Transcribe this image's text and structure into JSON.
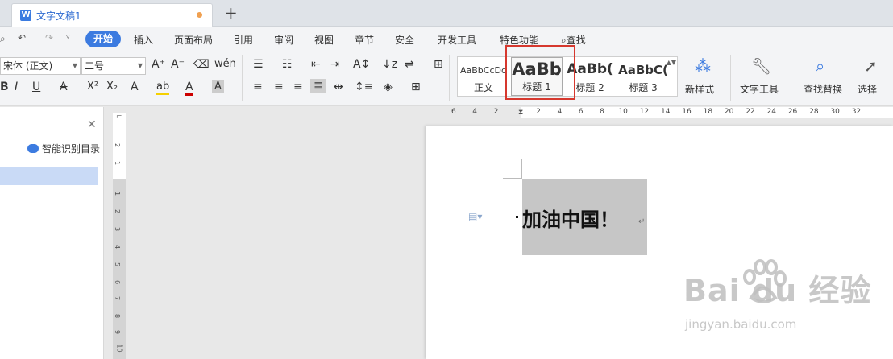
{
  "tabs": {
    "doc_title": "文字文稿1",
    "new_tab": "+"
  },
  "menu": {
    "items": [
      "开始",
      "插入",
      "页面布局",
      "引用",
      "审阅",
      "视图",
      "章节",
      "安全",
      "开发工具",
      "特色功能"
    ],
    "search": "查找"
  },
  "ribbon": {
    "font_name": "宋体 (正文)",
    "font_size": "二号",
    "styles": [
      {
        "sample": "AaBbCcDd",
        "label": "正文"
      },
      {
        "sample": "AaBb",
        "label": "标题 1"
      },
      {
        "sample": "AaBb(",
        "label": "标题 2"
      },
      {
        "sample": "AaBbC(",
        "label": "标题 3"
      }
    ],
    "new_style": "新样式",
    "text_tools": "文字工具",
    "find_replace": "查找替换",
    "select": "选择"
  },
  "nav": {
    "smart_toc": "智能识别目录"
  },
  "ruler": {
    "h_ticks": [
      "6",
      "4",
      "2",
      "",
      "2",
      "4",
      "6",
      "8",
      "10",
      "12",
      "14",
      "16",
      "18",
      "20",
      "22",
      "24",
      "26",
      "28",
      "30",
      "32"
    ],
    "v_ticks": [
      "2",
      "1",
      "1",
      "2",
      "3",
      "4",
      "5",
      "6",
      "7",
      "8",
      "9",
      "10"
    ]
  },
  "document": {
    "heading": "加油中国！",
    "paragraph_mark": "↵"
  },
  "watermark": {
    "brand": "Bai du 经验",
    "url": "jingyan.baidu.com"
  },
  "colors": {
    "accent": "#3c7be0",
    "highlight_border": "#d6382e",
    "selection": "#c6c6c6"
  }
}
